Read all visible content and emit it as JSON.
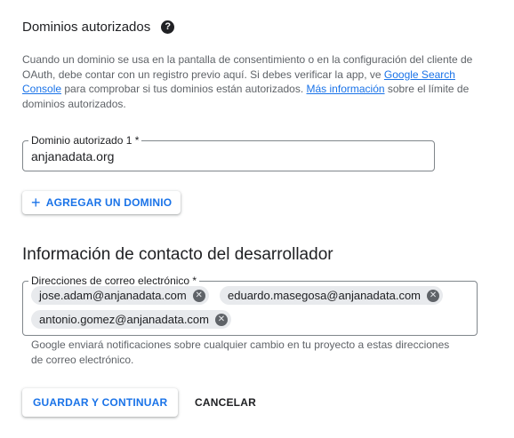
{
  "authorized_domains": {
    "title": "Dominios autorizados",
    "help_icon": "help-icon",
    "help_glyph": "?",
    "description": {
      "part1": "Cuando un dominio se usa en la pantalla de consentimiento o en la configuración del cliente de OAuth, debe contar con un registro previo aquí. Si debes verificar la app, ve ",
      "link1": "Google Search Console",
      "part2": " para comprobar si tus dominios están autorizados. ",
      "link2": "Más información",
      "part3": " sobre el límite de dominios autorizados."
    },
    "field_label": "Dominio autorizado 1 *",
    "field_value": "anjanadata.org",
    "add_button_icon": "plus-icon",
    "add_button_glyph": "+",
    "add_button_label": "AGREGAR UN DOMINIO"
  },
  "developer_contact": {
    "title": "Información de contacto del desarrollador",
    "field_label": "Direcciones de correo electrónico *",
    "emails": [
      "jose.adam@anjanadata.com",
      "eduardo.masegosa@anjanadata.com",
      "antonio.gomez@anjanadata.com"
    ],
    "chip_remove_icon": "close-icon",
    "chip_remove_glyph": "✕",
    "hint": "Google enviará notificaciones sobre cualquier cambio en tu proyecto a estas direcciones de correo electrónico."
  },
  "actions": {
    "save_label": "GUARDAR Y CONTINUAR",
    "cancel_label": "CANCELAR"
  },
  "colors": {
    "accent": "#1a73e8",
    "text": "#202124",
    "secondary_text": "#5f6368",
    "chip_bg": "#e8eaed"
  }
}
